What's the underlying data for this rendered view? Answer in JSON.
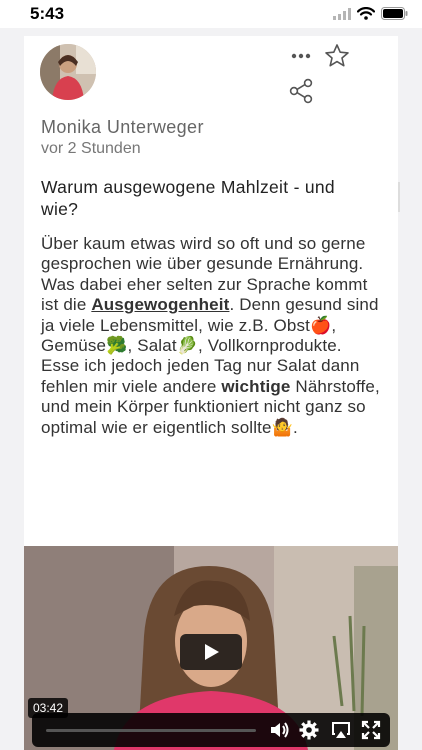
{
  "status": {
    "time": "5:43"
  },
  "post": {
    "author": "Monika Unterweger",
    "time_ago": "vor 2 Stunden",
    "title": "Warum ausgewogene Mahlzeit - und wie?",
    "body": [
      {
        "t": "Über kaum etwas wird so oft und so gerne gesprochen wie über gesunde Ernährung. Was dabei eher selten zur Sprache kommt ist die "
      },
      {
        "t": "Ausgewogenheit",
        "u": true
      },
      {
        "t": ".  Denn gesund sind ja viele Lebensmittel, wie z.B. Obst🍎, Gemüse🥦, Salat🥬, Vollkornprodukte. Esse ich jedoch jeden Tag nur Salat dann fehlen mir viele andere "
      },
      {
        "t": "wichtige",
        "b": true
      },
      {
        "t": " Nährstoffe, und mein Körper funktioniert nicht ganz so optimal wie er eigentlich sollte🤷."
      }
    ]
  },
  "video": {
    "duration": "03:42"
  },
  "icons": {
    "signal": "cellular-signal-icon",
    "wifi": "wifi-icon",
    "battery": "battery-icon",
    "more": "more-dots-icon",
    "star": "star-icon",
    "share": "share-icon",
    "play": "play-icon",
    "volume": "volume-icon",
    "settings": "gear-icon",
    "airplay": "airplay-icon",
    "fullscreen": "fullscreen-icon"
  }
}
